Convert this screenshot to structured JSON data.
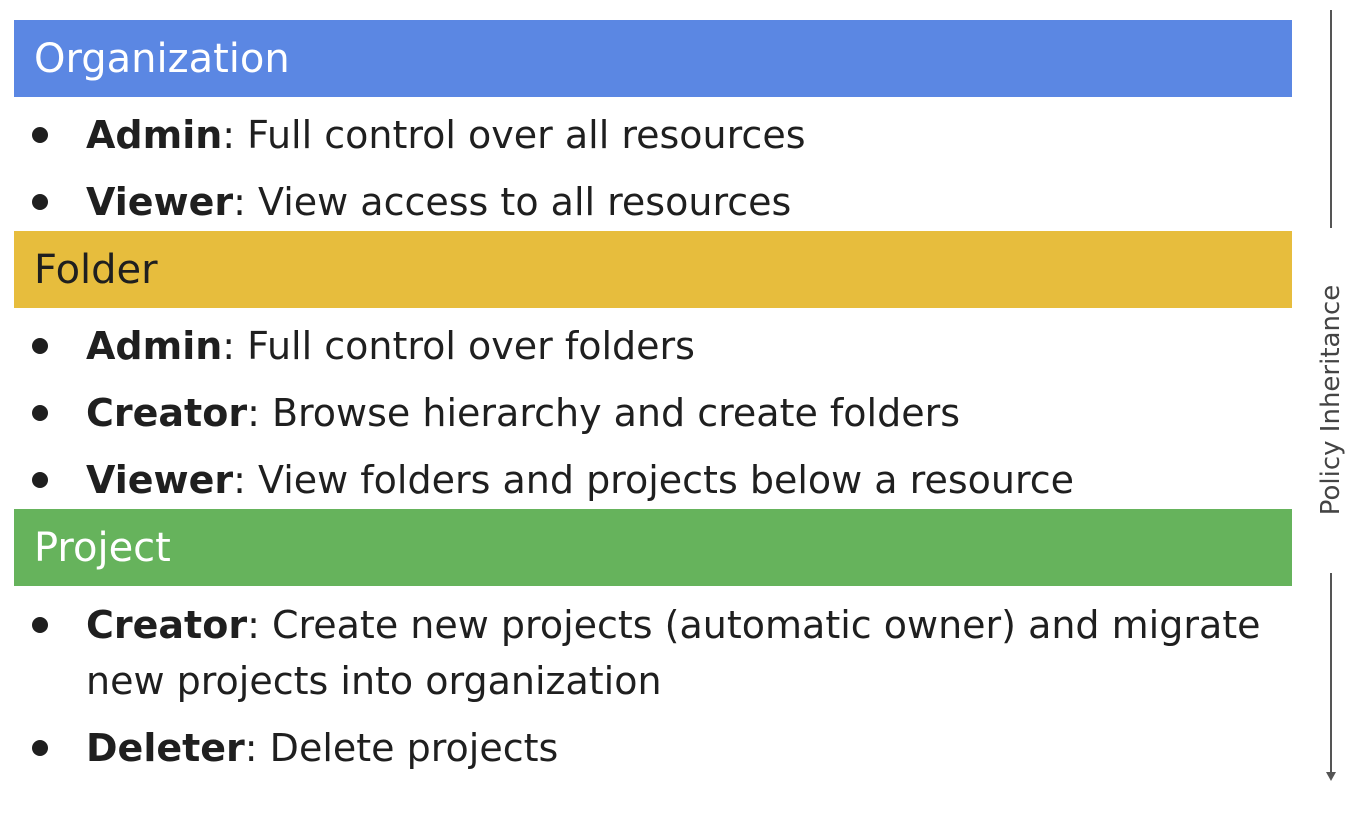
{
  "colors": {
    "organization": "#5B87E3",
    "folder": "#E7BD3D",
    "project": "#66B35C",
    "text": "#1f1f1f",
    "arrow": "#555555"
  },
  "arrow_label": "Policy Inheritance",
  "sections": {
    "organization": {
      "title": "Organization",
      "items": [
        {
          "role": "Admin",
          "desc": ": Full control over all resources"
        },
        {
          "role": "Viewer",
          "desc": ": View access to all resources"
        }
      ]
    },
    "folder": {
      "title": "Folder",
      "items": [
        {
          "role": "Admin",
          "desc": ": Full control over folders"
        },
        {
          "role": "Creator",
          "desc": ": Browse hierarchy and create folders"
        },
        {
          "role": "Viewer",
          "desc": ": View folders and projects below a resource"
        }
      ]
    },
    "project": {
      "title": "Project",
      "items": [
        {
          "role": "Creator",
          "desc": ": Create new projects (automatic owner) and migrate new projects into organization"
        },
        {
          "role": "Deleter",
          "desc": ": Delete projects"
        }
      ]
    }
  }
}
